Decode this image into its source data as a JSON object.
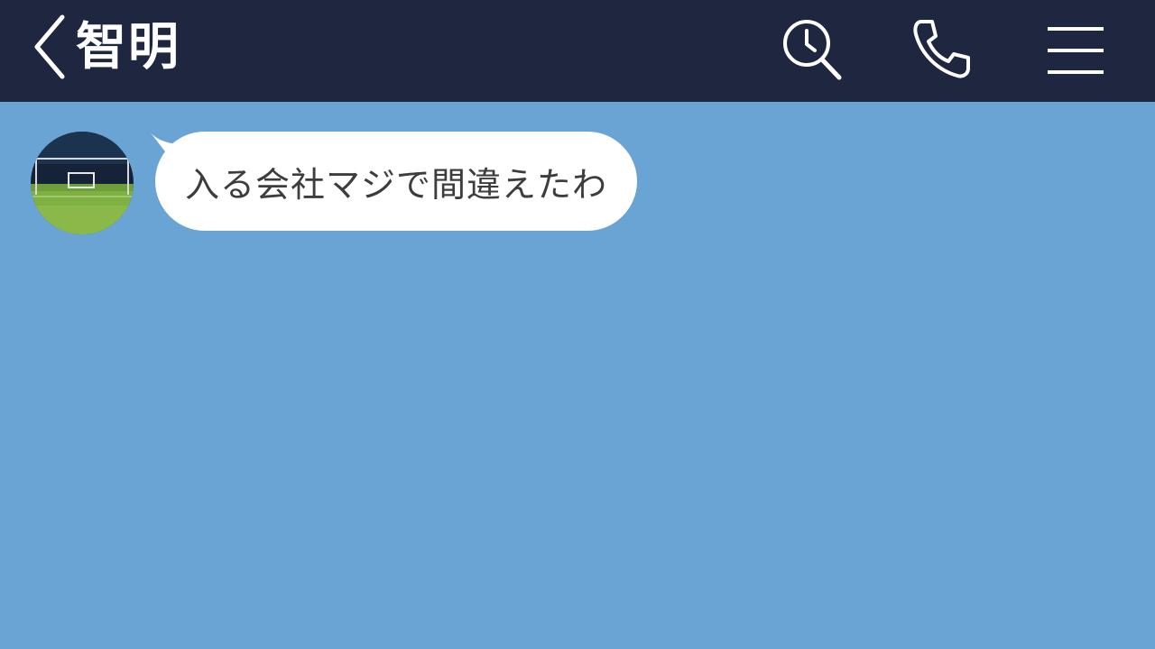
{
  "header": {
    "title": "智明",
    "back_icon": "chevron-left-icon",
    "search_icon": "search-history-icon",
    "call_icon": "phone-icon",
    "menu_icon": "hamburger-menu-icon",
    "bg_color": "#1f2740"
  },
  "chat": {
    "bg_color": "#6aa4d4",
    "messages": [
      {
        "sender": "other",
        "avatar": "soccer-field-avatar",
        "text": "入る会社マジで間違えたわ"
      }
    ]
  }
}
